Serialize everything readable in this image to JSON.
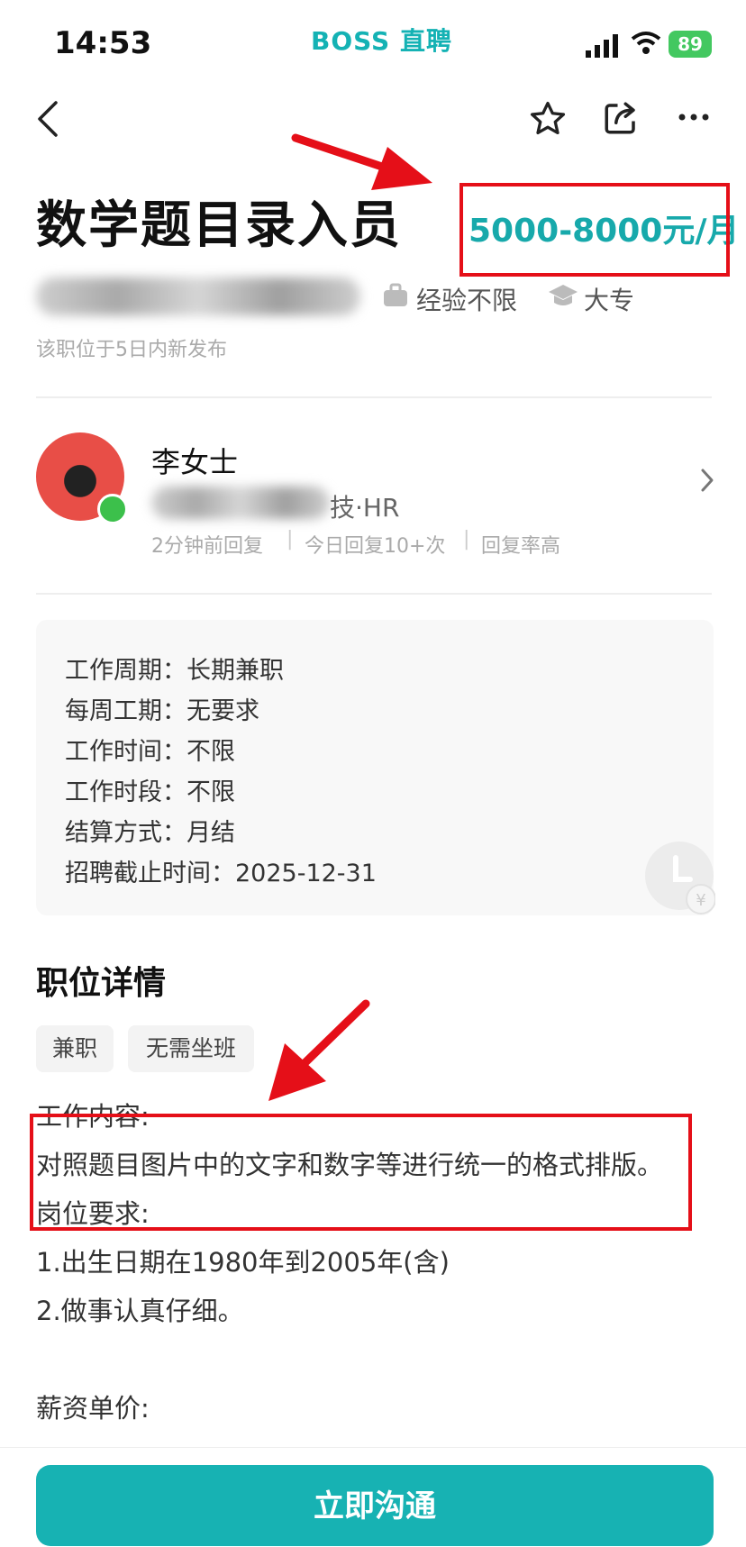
{
  "status_bar": {
    "time": "14:53",
    "app_brand": "BOSS 直聘",
    "battery": "89"
  },
  "job": {
    "title": "数学题目录入员",
    "salary": "5000-8000元/月",
    "experience": "经验不限",
    "education": "大专",
    "posted": "该职位于5日内新发布"
  },
  "recruiter": {
    "name": "李女士",
    "company_suffix": "技·HR",
    "activity": [
      "2分钟前回复",
      "今日回复10+次",
      "回复率高"
    ]
  },
  "info_card": [
    {
      "label": "工作周期：",
      "value": "长期兼职"
    },
    {
      "label": "每周工期：",
      "value": "无要求"
    },
    {
      "label": "工作时间：",
      "value": "不限"
    },
    {
      "label": "工作时段：",
      "value": "不限"
    },
    {
      "label": "结算方式：",
      "value": "月结"
    },
    {
      "label": "招聘截止时间：",
      "value": "2025-12-31"
    }
  ],
  "details": {
    "section_title": "职位详情",
    "tags": [
      "兼职",
      "无需坐班"
    ],
    "lines": [
      "工作内容:",
      "对照题目图片中的文字和数字等进行统一的格式排版。",
      "岗位要求:",
      "1.出生日期在1980年到2005年(含)",
      "2.做事认真仔细。",
      "薪资单价:"
    ]
  },
  "cta": {
    "label": "立即沟通"
  },
  "colors": {
    "accent": "#17b2b3",
    "annotation": "#e50f18"
  }
}
